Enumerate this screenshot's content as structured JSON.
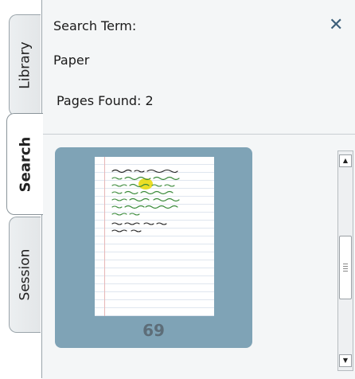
{
  "tabs": [
    {
      "label": "Library"
    },
    {
      "label": "Search"
    },
    {
      "label": "Session"
    }
  ],
  "active_tab": "Search",
  "search": {
    "term_label": "Search Term:",
    "term_value": "Paper",
    "pages_found_label": "Pages Found:",
    "pages_found_count": "2",
    "close_symbol": "✕"
  },
  "results": [
    {
      "page_number": "69"
    }
  ],
  "scrollbar": {
    "up_symbol": "▲",
    "down_symbol": "▼"
  },
  "colors": {
    "card": "#7fa3b6",
    "page_number": "#5d6d78",
    "ink": "#3a8a3a",
    "highlight": "#e8d800",
    "close": "#3d5f7a"
  }
}
